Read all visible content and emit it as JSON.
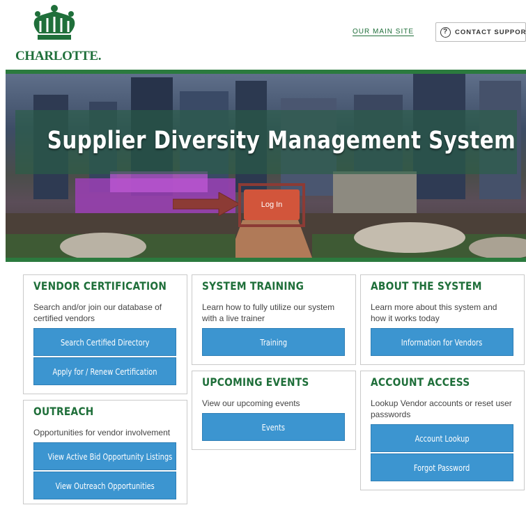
{
  "header": {
    "logo_text": "CHARLOTTE.",
    "main_site_link": "OUR MAIN SITE",
    "contact_support": "CONTACT SUPPORT",
    "contact_icon": "?"
  },
  "hero": {
    "title": "Supplier Diversity Management System",
    "login_button": "Log In"
  },
  "cards": {
    "vendor_certification": {
      "title": "VENDOR CERTIFICATION",
      "description": "Search and/or join our database of certified vendors",
      "buttons": [
        "Search Certified Directory",
        "Apply for / Renew Certification"
      ]
    },
    "outreach": {
      "title": "OUTREACH",
      "description": "Opportunities for vendor involvement",
      "buttons": [
        "View Active Bid Opportunity Listings",
        "View Outreach Opportunities"
      ]
    },
    "system_training": {
      "title": "SYSTEM TRAINING",
      "description": "Learn how to fully utilize our system with a live trainer",
      "buttons": [
        "Training"
      ]
    },
    "upcoming_events": {
      "title": "UPCOMING EVENTS",
      "description": "View our upcoming events",
      "buttons": [
        "Events"
      ]
    },
    "about_system": {
      "title": "ABOUT THE SYSTEM",
      "description": "Learn more about this system and how it works today",
      "buttons": [
        "Information for Vendors"
      ]
    },
    "account_access": {
      "title": "ACCOUNT ACCESS",
      "description": "Lookup Vendor accounts or reset user passwords",
      "buttons": [
        "Account Lookup",
        "Forgot Password"
      ]
    }
  },
  "colors": {
    "brand_green": "#1f6f3a",
    "button_blue": "#3c95d0",
    "login_red": "#d2553b"
  }
}
